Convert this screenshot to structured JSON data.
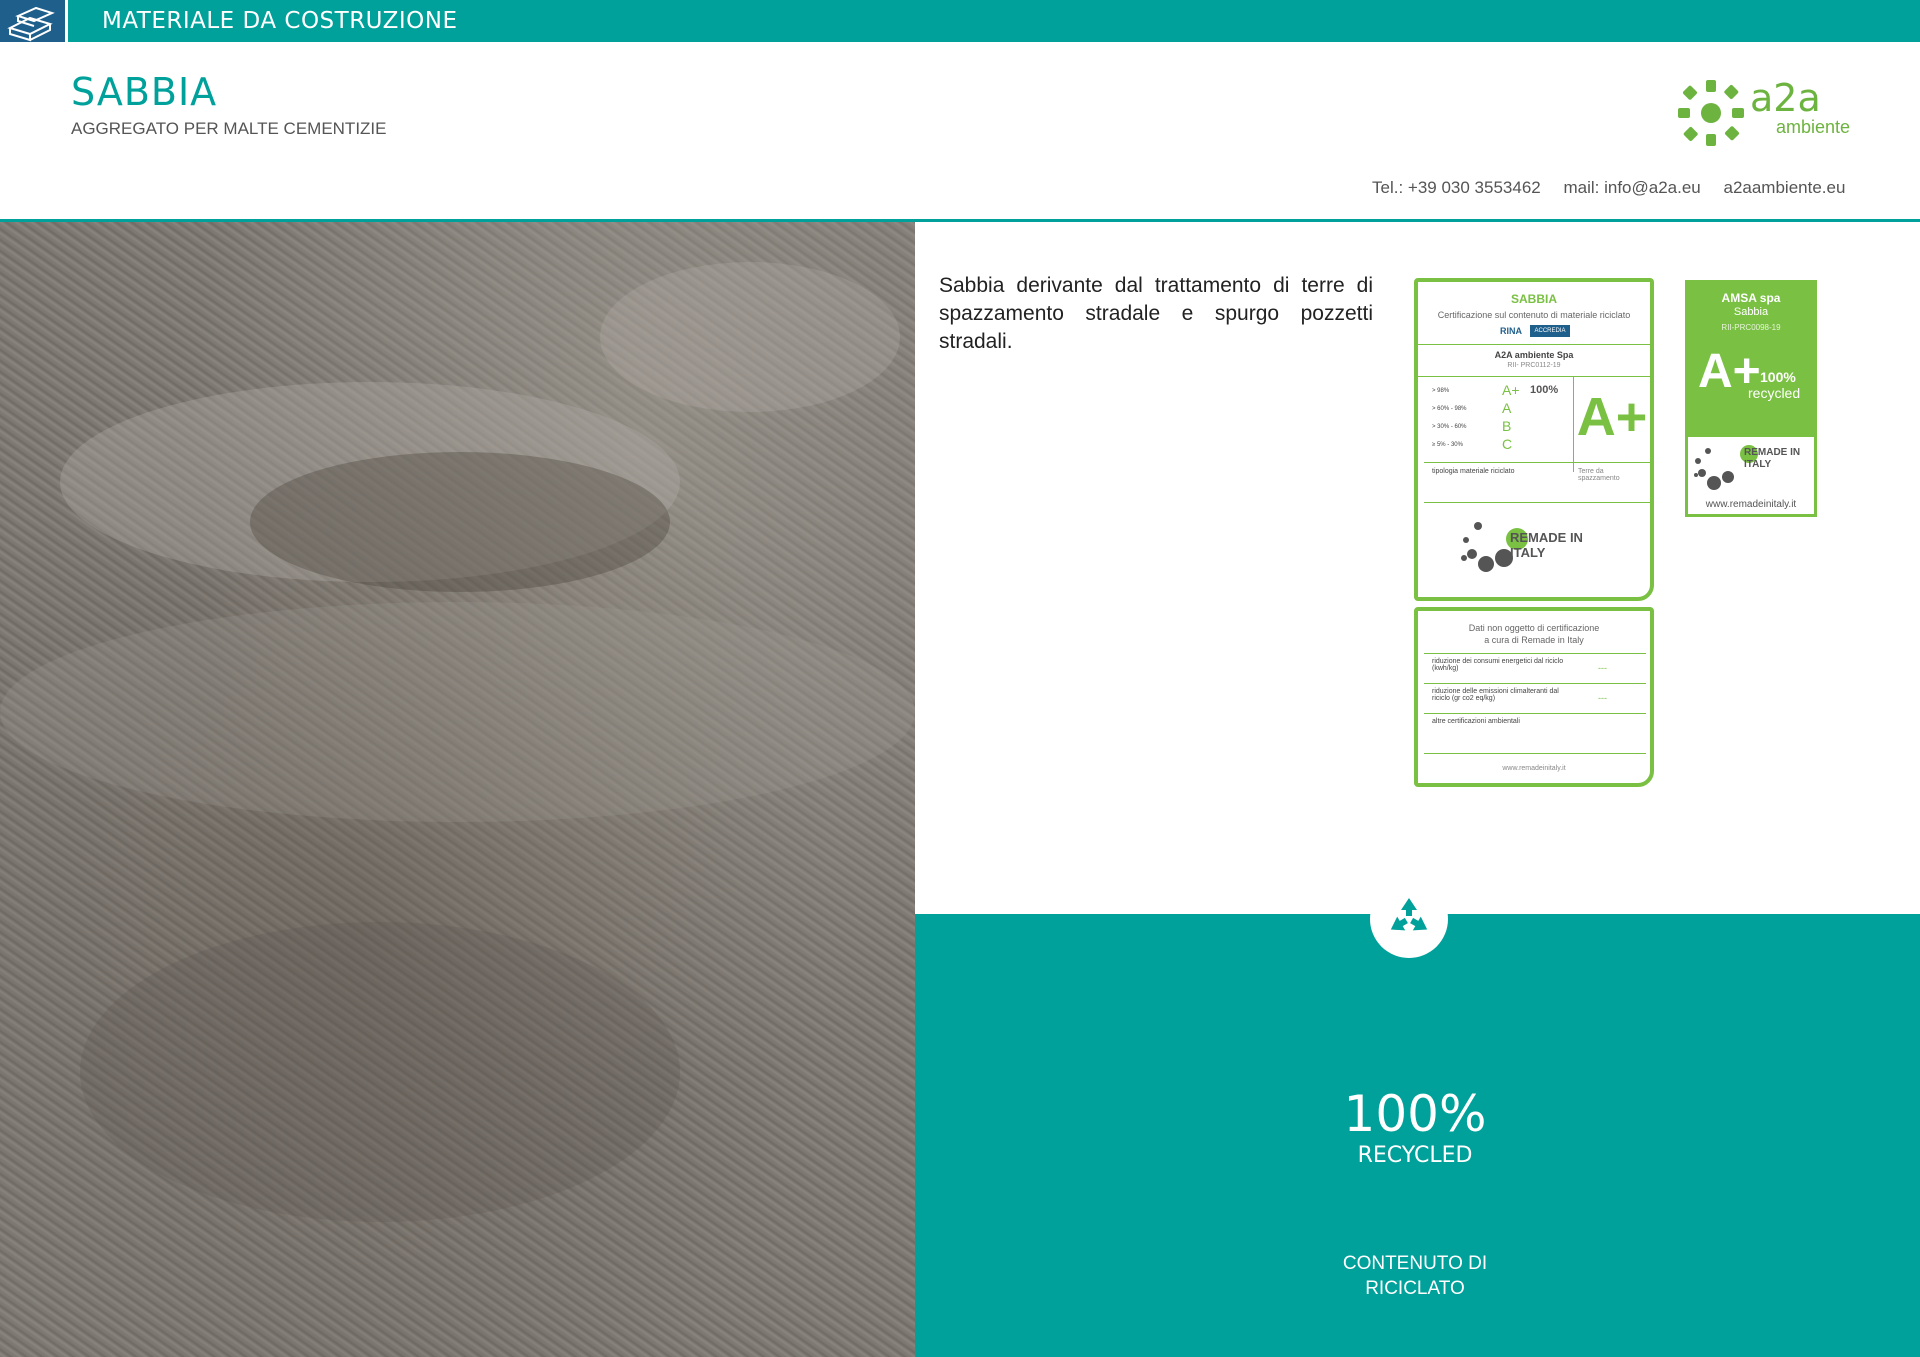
{
  "header": {
    "category": "MATERIALE DA COSTRUZIONE",
    "title": "SABBIA",
    "subtitle": "AGGREGATO PER MALTE CEMENTIZIE"
  },
  "logo": {
    "word": "a2a",
    "sub": "ambiente"
  },
  "contacts": {
    "tel": "Tel.:  +39 030 3553462",
    "mail": "mail: info@a2a.eu",
    "web": "a2aambiente.eu"
  },
  "description": "Sabbia derivante dal trattamento di terre di spazzamento stradale e spurgo pozzetti stradali.",
  "cert_main": {
    "title": "SABBIA",
    "subtitle": "Certificazione sul contenuto di materiale riciclato",
    "org_rina": "RINA",
    "org_accredia": "ACCREDIA",
    "company": "A2A ambiente Spa",
    "code": "RII- PRC0112-19",
    "rows": [
      {
        "range": "> 98%",
        "grade": "A+"
      },
      {
        "range": "> 60% - 98%",
        "grade": "A"
      },
      {
        "range": "> 30% - 60%",
        "grade": "B"
      },
      {
        "range": "≥  5% - 30%",
        "grade": "C"
      }
    ],
    "pct": "100%",
    "big_grade": "A+",
    "tipologia_label": "tipologia materiale riciclato",
    "tipologia_value": "Terre da spazzamento",
    "brand": "REMADE IN ITALY"
  },
  "cert_data": {
    "title_line1": "Dati non oggetto di certificazione",
    "title_line2": "a cura di Remade in Italy",
    "row1_label": "riduzione dei consumi energetici dal riciclo (kwh/kg)",
    "row1_value": "---",
    "row2_label": "riduzione delle emissioni climalteranti dal riciclo (gr co2 eq/kg)",
    "row2_value": "---",
    "row3_label": "altre certificazioni ambientali",
    "footer": "www.remadeinitaly.it"
  },
  "cert_small": {
    "company": "AMSA spa",
    "material": "Sabbia",
    "code": "RII-PRC0098-19",
    "grade": "A+",
    "pct": "100%",
    "recycled": "recycled",
    "brand": "REMADE IN ITALY",
    "footer": "www.remadeinitaly.it"
  },
  "stats": {
    "pct": "100%",
    "recycled": "RECYCLED",
    "label_line1": "CONTENUTO DI",
    "label_line2": "RICICLATO"
  },
  "icons": {
    "category": "bricks-icon",
    "recycle": "recycle-icon"
  },
  "colors": {
    "teal": "#00a19b",
    "green": "#7ac143",
    "dark_blue": "#1f5f8c"
  }
}
